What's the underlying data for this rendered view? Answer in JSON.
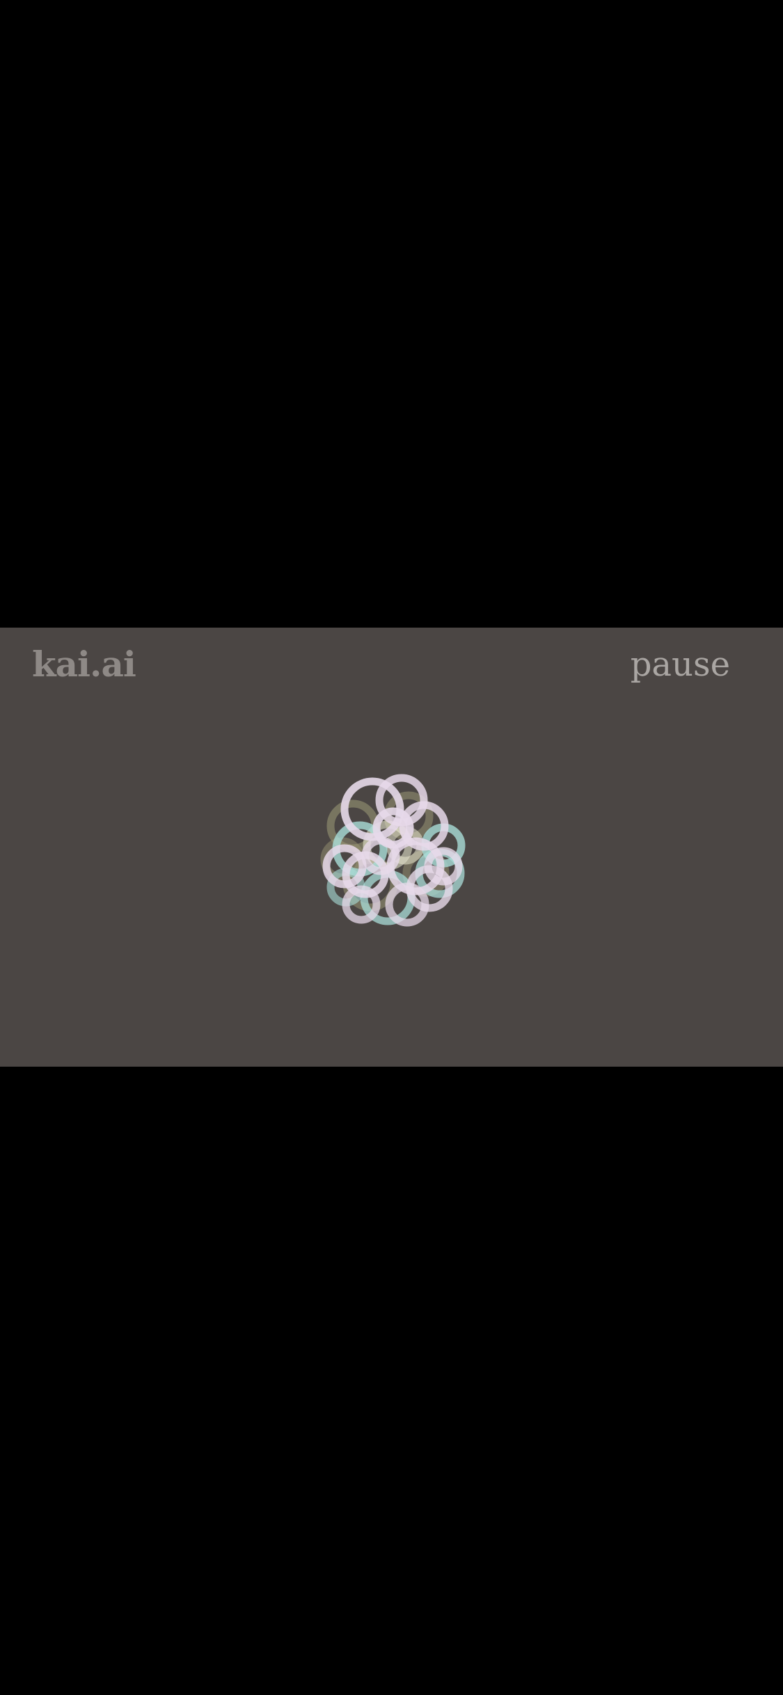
{
  "header": {
    "brand": "kai.ai",
    "pause_label": "pause"
  },
  "breath_visual": {
    "icon": "breathing-flower-icon",
    "colors": {
      "lavender": "#e7d9ea",
      "mint": "#a9ddd8",
      "olive": "#9f9c78",
      "cream": "#efeed6"
    }
  },
  "colors": {
    "background": "#000000",
    "frame": "#4b4644",
    "brand_text": "#8e8986",
    "pause_text": "#aaa6a3"
  }
}
